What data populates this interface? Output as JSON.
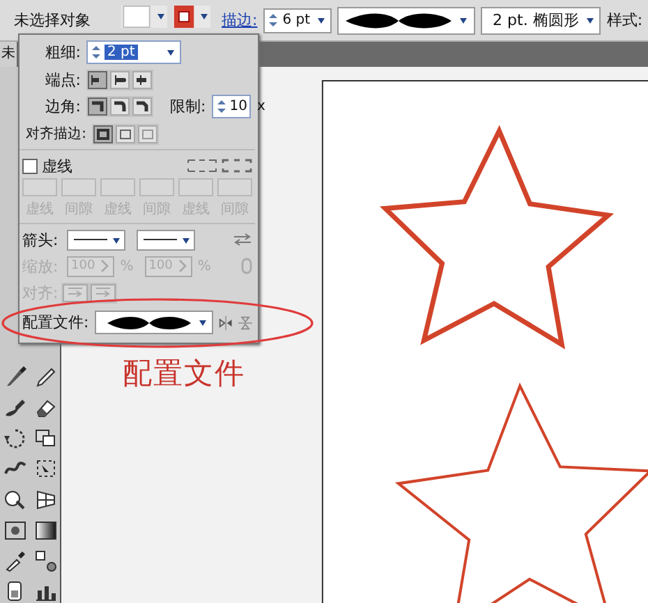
{
  "control_bar": {
    "selection_label": "未选择对象",
    "stroke_link": "描边:",
    "stroke_weight": "6 pt",
    "brush": "2 pt. 椭圆形",
    "style_label": "样式:"
  },
  "doc_tab": "未",
  "stroke_panel": {
    "weight_label": "粗细:",
    "weight": "2 pt",
    "cap_label": "端点:",
    "caps": [
      {
        "selected": true
      },
      {
        "selected": false
      },
      {
        "selected": false
      }
    ],
    "corner_label": "边角:",
    "corners": [
      {
        "selected": true
      },
      {
        "selected": false
      },
      {
        "selected": false
      }
    ],
    "limit_label": "限制:",
    "limit": "10",
    "limit_unit": "x",
    "align_label": "对齐描边:",
    "aligns": [
      {
        "selected": true
      },
      {
        "selected": false
      },
      {
        "selected": false
      }
    ],
    "dashed": {
      "label": "虚线",
      "checked": false
    },
    "dash_fields": [
      {
        "label": "虚线"
      },
      {
        "label": "间隙"
      },
      {
        "label": "虚线"
      },
      {
        "label": "间隙"
      },
      {
        "label": "虚线"
      },
      {
        "label": "间隙"
      }
    ],
    "arrow_label": "箭头:",
    "scale": {
      "label": "缩放:",
      "start": "100",
      "start_unit": "%",
      "end": "100",
      "end_unit": "%",
      "disabled": true
    },
    "arrow_align": {
      "label": "对齐:",
      "disabled": true
    },
    "profile_label": "配置文件:"
  },
  "annotation": "配置文件"
}
